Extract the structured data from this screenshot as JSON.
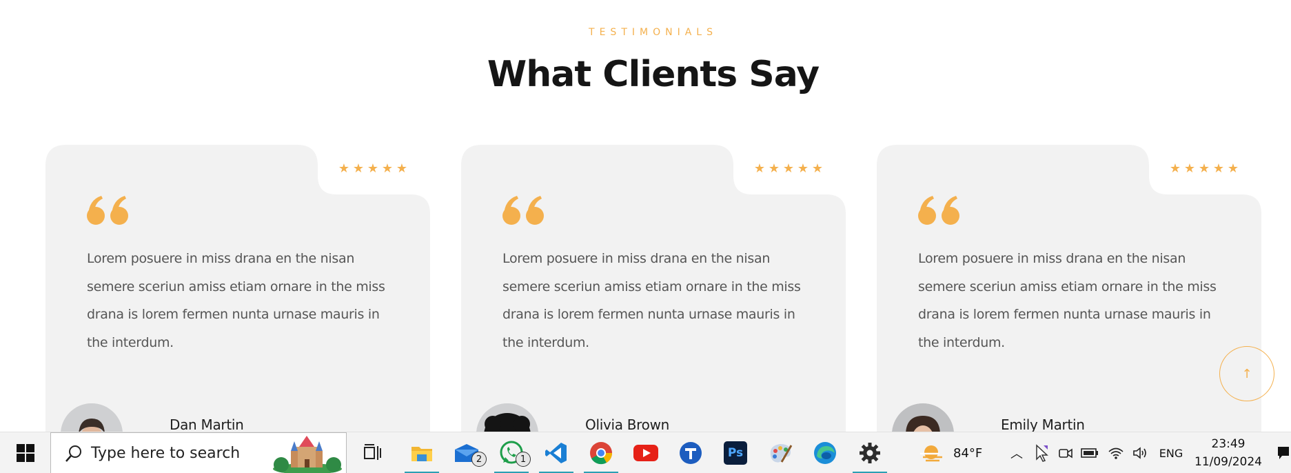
{
  "section": {
    "eyebrow": "TESTIMONIALS",
    "title": "What Clients Say"
  },
  "colors": {
    "accent": "#f4b04d",
    "card_bg": "#f2f2f2",
    "text": "#555555",
    "heading": "#151515",
    "taskbar_bg": "#f3f3f3"
  },
  "testimonials": [
    {
      "name": "Dan Martin",
      "rating": 5,
      "text": "Lorem posuere in miss drana en the nisan semere sceriun amiss etiam ornare in the miss drana is lorem fermen nunta urnase mauris in the interdum."
    },
    {
      "name": "Olivia Brown",
      "rating": 5,
      "text": "Lorem posuere in miss drana en the nisan semere sceriun amiss etiam ornare in the miss drana is lorem fermen nunta urnase mauris in the interdum."
    },
    {
      "name": "Emily Martin",
      "rating": 5,
      "text": "Lorem posuere in miss drana en the nisan semere sceriun amiss etiam ornare in the miss drana is lorem fermen nunta urnase mauris in the interdum."
    }
  ],
  "scroll_top": {
    "icon": "arrow-up-icon"
  },
  "taskbar": {
    "search_placeholder": "Type here to search",
    "apps": [
      {
        "name": "task-view",
        "icon": "task-view-icon"
      },
      {
        "name": "file-explorer",
        "icon": "folder-icon",
        "active": true
      },
      {
        "name": "mail",
        "icon": "mail-icon",
        "badge": "2"
      },
      {
        "name": "whatsapp",
        "icon": "whatsapp-icon",
        "badge": "1",
        "active": true
      },
      {
        "name": "vscode",
        "icon": "vscode-icon",
        "active": true
      },
      {
        "name": "chrome",
        "icon": "chrome-icon",
        "active": true
      },
      {
        "name": "youtube",
        "icon": "youtube-icon"
      },
      {
        "name": "t-app",
        "icon": "t-app-icon"
      },
      {
        "name": "photoshop",
        "icon": "photoshop-icon",
        "label": "Ps"
      },
      {
        "name": "paint",
        "icon": "paint-palette-icon"
      },
      {
        "name": "edge",
        "icon": "edge-icon"
      },
      {
        "name": "settings",
        "icon": "gear-icon",
        "active": true
      }
    ],
    "weather": "84°F",
    "language": "ENG",
    "time": "23:49",
    "date": "11/09/2024"
  }
}
